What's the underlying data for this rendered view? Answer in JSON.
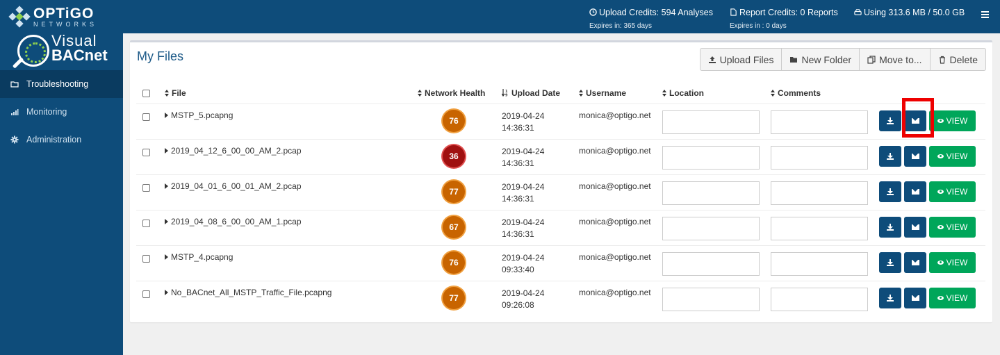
{
  "brand": {
    "name": "OPTiGO",
    "sub": "NETWORKS"
  },
  "logo": {
    "line1": "Visual",
    "line2": "BACnet"
  },
  "header": {
    "upload_credits": "Upload Credits: 594 Analyses",
    "upload_expires": "Expires in: 365 days",
    "report_credits": "Report Credits: 0 Reports",
    "report_expires": "Expires in : 0 days",
    "storage": "Using 313.6 MB / 50.0 GB"
  },
  "sidebar": {
    "items": [
      {
        "label": "Troubleshooting",
        "icon": "folder-icon",
        "active": true
      },
      {
        "label": "Monitoring",
        "icon": "bar-chart-icon",
        "active": false
      },
      {
        "label": "Administration",
        "icon": "gear-icon",
        "active": false
      }
    ]
  },
  "main": {
    "title": "My Files",
    "toolbar": {
      "upload_label": "Upload Files",
      "new_folder_label": "New Folder",
      "move_label": "Move to...",
      "delete_label": "Delete"
    },
    "columns": {
      "file": "File",
      "health": "Network Health",
      "date": "Upload Date",
      "username": "Username",
      "location": "Location",
      "comments": "Comments"
    },
    "view_label": "VIEW",
    "rows": [
      {
        "file": "MSTP_5.pcapng",
        "health": "76",
        "health_color": "#c86400",
        "date": "2019-04-24",
        "time": "14:36:31",
        "username": "monica@optigo.net",
        "location": "",
        "comments": ""
      },
      {
        "file": "2019_04_12_6_00_00_AM_2.pcap",
        "health": "36",
        "health_color": "#a01010",
        "date": "2019-04-24",
        "time": "14:36:31",
        "username": "monica@optigo.net",
        "location": "",
        "comments": ""
      },
      {
        "file": "2019_04_01_6_00_01_AM_2.pcap",
        "health": "77",
        "health_color": "#c86400",
        "date": "2019-04-24",
        "time": "14:36:31",
        "username": "monica@optigo.net",
        "location": "",
        "comments": ""
      },
      {
        "file": "2019_04_08_6_00_00_AM_1.pcap",
        "health": "67",
        "health_color": "#c86400",
        "date": "2019-04-24",
        "time": "14:36:31",
        "username": "monica@optigo.net",
        "location": "",
        "comments": ""
      },
      {
        "file": "MSTP_4.pcapng",
        "health": "76",
        "health_color": "#c86400",
        "date": "2019-04-24",
        "time": "09:33:40",
        "username": "monica@optigo.net",
        "location": "",
        "comments": ""
      },
      {
        "file": "No_BACnet_All_MSTP_Traffic_File.pcapng",
        "health": "77",
        "health_color": "#c86400",
        "date": "2019-04-24",
        "time": "09:26:08",
        "username": "monica@optigo.net",
        "location": "",
        "comments": ""
      }
    ]
  },
  "colors": {
    "primary": "#0e4c7a",
    "success": "#00a65a",
    "highlight": "#ee0000"
  }
}
